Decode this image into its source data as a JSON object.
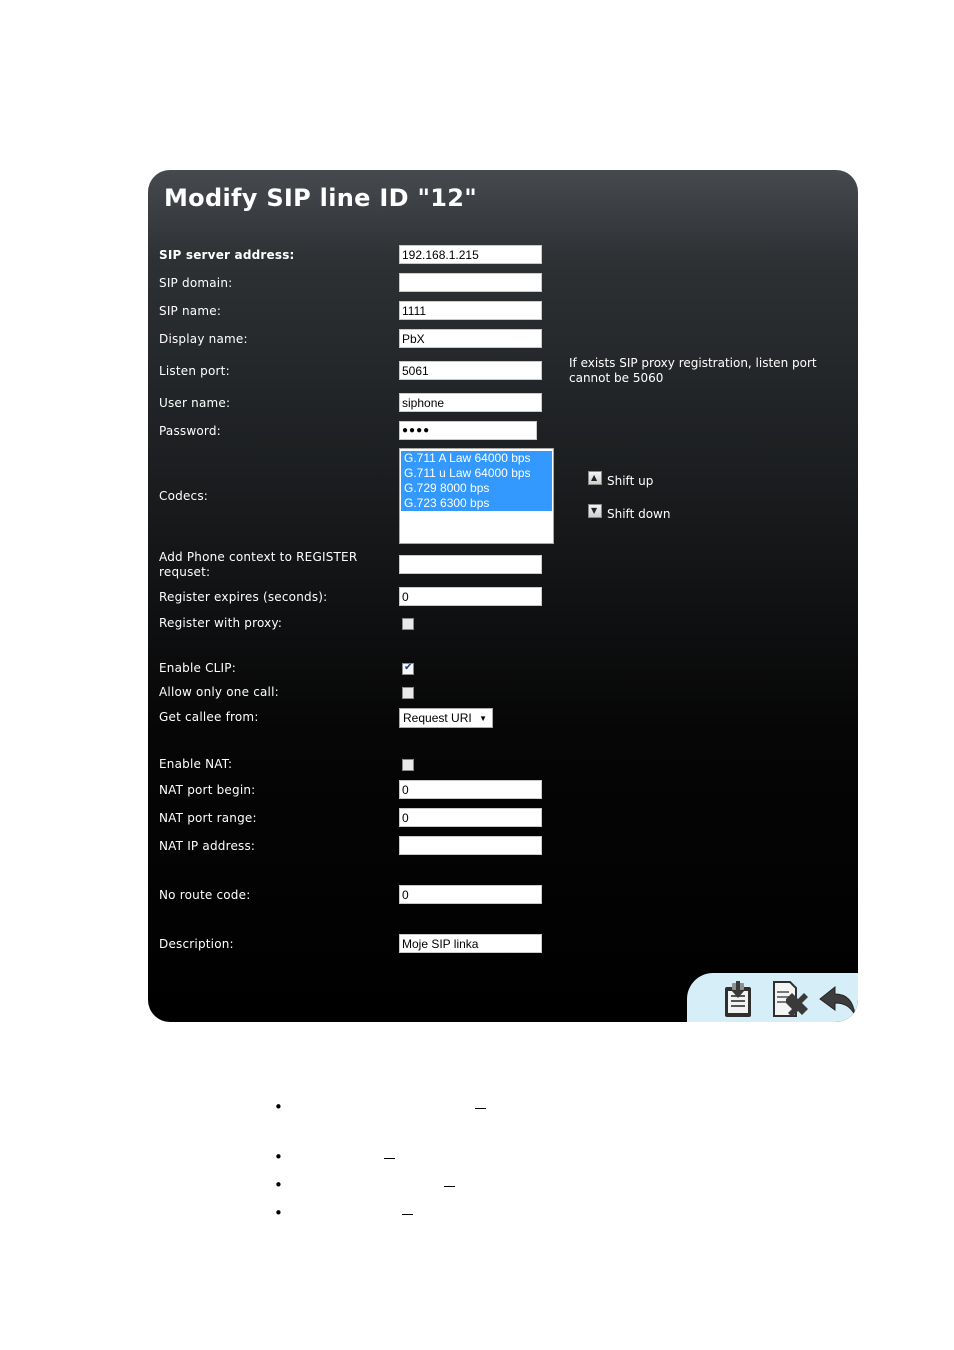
{
  "dialog": {
    "title": "Modify SIP line ID \"12\"",
    "fields": {
      "sip_server_address": {
        "label": "SIP server address:",
        "value": "192.168.1.215"
      },
      "sip_domain": {
        "label": "SIP domain:",
        "value": ""
      },
      "sip_name": {
        "label": "SIP name:",
        "value": "1111"
      },
      "display_name": {
        "label": "Display name:",
        "value": "PbX"
      },
      "listen_port": {
        "label": "Listen port:",
        "value": "5061",
        "note": "If exists SIP proxy registration, listen port cannot be 5060"
      },
      "user_name": {
        "label": "User name:",
        "value": "siphone"
      },
      "password": {
        "label": "Password:",
        "value": "●●●●"
      },
      "codecs": {
        "label": "Codecs:",
        "options": [
          "G.711 A Law 64000 bps",
          "G.711 u Law 64000 bps",
          "G.729 8000 bps",
          "G.723 6300 bps"
        ],
        "shift_up": "Shift up",
        "shift_down": "Shift down"
      },
      "phone_context": {
        "label": "Add Phone context to REGISTER requset:",
        "value": ""
      },
      "register_expires": {
        "label": "Register expires (seconds):",
        "value": "0"
      },
      "register_with_proxy": {
        "label": "Register with proxy:",
        "checked": false
      },
      "enable_clip": {
        "label": "Enable CLIP:",
        "checked": true
      },
      "allow_one_call": {
        "label": "Allow only one call:",
        "checked": false
      },
      "get_callee_from": {
        "label": "Get callee from:",
        "value": "Request URI"
      },
      "enable_nat": {
        "label": "Enable NAT:",
        "checked": false
      },
      "nat_port_begin": {
        "label": "NAT port begin:",
        "value": "0"
      },
      "nat_port_range": {
        "label": "NAT port range:",
        "value": "0"
      },
      "nat_ip_address": {
        "label": "NAT IP address:",
        "value": ""
      },
      "no_route_code": {
        "label": "No route code:",
        "value": "0"
      },
      "description": {
        "label": "Description:",
        "value": "Moje SIP linka"
      }
    },
    "toolbar": {
      "icons": [
        "save-icon",
        "delete-icon",
        "back-icon"
      ]
    }
  },
  "colors": {
    "selected_option": "#3399ff",
    "toolbar_tray": "#d5eef8"
  },
  "bullets": [
    "•",
    "•",
    "•",
    "•"
  ]
}
